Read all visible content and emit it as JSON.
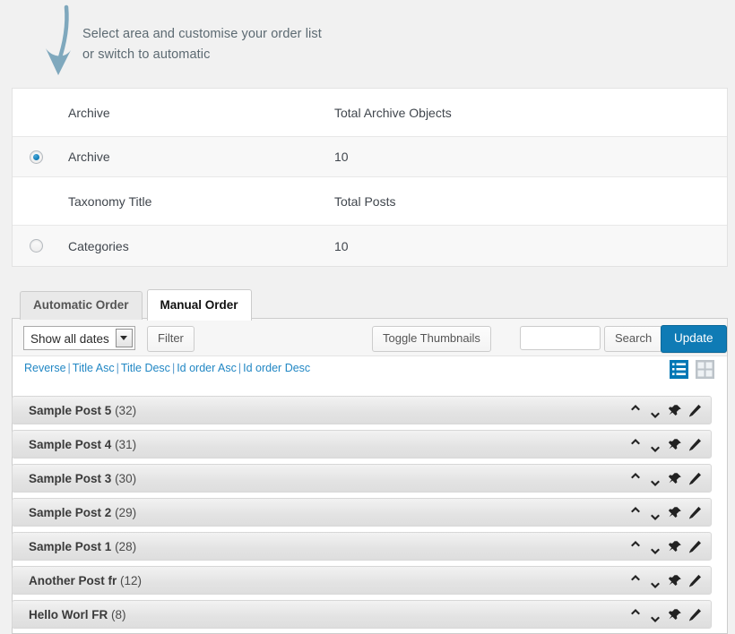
{
  "annotation": {
    "line1": "Select area and customise your order list",
    "line2": "or switch to automatic",
    "arrow_color": "#7fa8bd"
  },
  "archive_table": {
    "header_archive": {
      "title": "Archive",
      "count_label": "Total Archive Objects"
    },
    "archive_row": {
      "title": "Archive",
      "count": "10",
      "selected": true
    },
    "header_taxonomy": {
      "title": "Taxonomy Title",
      "count_label": "Total Posts"
    },
    "taxonomy_row": {
      "title": "Categories",
      "count": "10",
      "selected": false
    }
  },
  "tabs": {
    "automatic": "Automatic Order",
    "manual": "Manual Order",
    "active": "Manual Order"
  },
  "toolbar": {
    "date_filter_value": "Show all dates",
    "filter_label": "Filter",
    "toggle_thumbnails_label": "Toggle Thumbnails",
    "search_value": "",
    "search_placeholder": "",
    "search_label": "Search",
    "update_label": "Update",
    "update_color": "#0f7bb5"
  },
  "sort_links": {
    "reverse": "Reverse",
    "title_asc": "Title Asc",
    "title_desc": "Title Desc",
    "id_asc": "Id order Asc",
    "id_desc": "Id order Desc",
    "separator": "|",
    "link_color": "#2187c4"
  },
  "view_toggles": {
    "list_active": true,
    "list_color": "#0077b5",
    "grid_color": "#bcc3c9"
  },
  "posts": [
    {
      "title": "Sample Post 5",
      "id": "(32)"
    },
    {
      "title": "Sample Post 4",
      "id": "(31)"
    },
    {
      "title": "Sample Post 3",
      "id": "(30)"
    },
    {
      "title": "Sample Post 2",
      "id": "(29)"
    },
    {
      "title": "Sample Post 1",
      "id": "(28)"
    },
    {
      "title": "Another Post fr",
      "id": "(12)"
    },
    {
      "title": "Hello Worl FR",
      "id": "(8)"
    }
  ],
  "row_actions": [
    "move-up-icon",
    "move-down-icon",
    "pin-icon",
    "edit-icon"
  ]
}
